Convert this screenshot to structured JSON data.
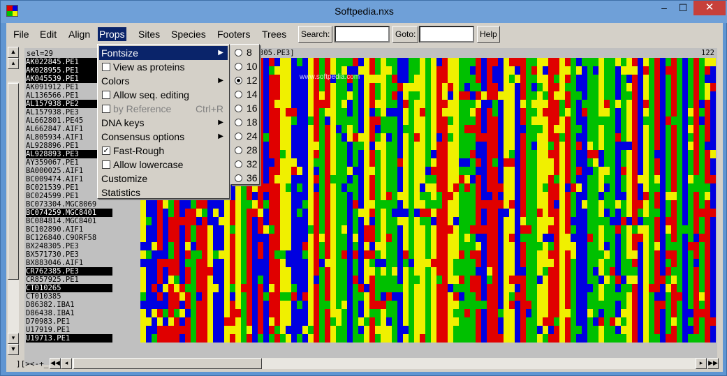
{
  "window": {
    "title": "Softpedia.nxs",
    "minimize": "–",
    "maximize": "☐",
    "close": "✕"
  },
  "menubar": {
    "items": [
      "File",
      "Edit",
      "Align",
      "Props",
      "Sites",
      "Species",
      "Footers",
      "Trees"
    ],
    "active": "Props",
    "search_label": "Search:",
    "search_value": "",
    "goto_label": "Goto:",
    "goto_value": "",
    "help_label": "Help"
  },
  "alignment": {
    "sel_text": "sel=29",
    "header_text": "305.PE3]",
    "position": "122",
    "names": [
      {
        "name": "AK022845.PE1",
        "selected": true
      },
      {
        "name": "AK028955.PE1",
        "selected": true
      },
      {
        "name": "AK045539.PE1",
        "selected": true
      },
      {
        "name": "AK091912.PE1",
        "selected": false
      },
      {
        "name": "AL136566.PE1",
        "selected": false
      },
      {
        "name": "AL157938.PE2",
        "selected": true
      },
      {
        "name": "AL157938.PE3",
        "selected": false
      },
      {
        "name": "AL662801.PE45",
        "selected": false
      },
      {
        "name": "AL662847.AIF1",
        "selected": false
      },
      {
        "name": "AL805934.AIF1",
        "selected": false
      },
      {
        "name": "AL928896.PE1",
        "selected": false
      },
      {
        "name": "AL928893.PE3",
        "selected": true
      },
      {
        "name": "AY359067.PE1",
        "selected": false
      },
      {
        "name": "BA000025.AIF1",
        "selected": false
      },
      {
        "name": "BC009474.AIF1",
        "selected": false
      },
      {
        "name": "BC021539.PE1",
        "selected": false
      },
      {
        "name": "BC024599.PE1",
        "selected": false
      },
      {
        "name": "BC073304.MGC8069",
        "selected": false
      },
      {
        "name": "BC074259.MGC8401",
        "selected": true
      },
      {
        "name": "BC084814.MGC8401",
        "selected": false
      },
      {
        "name": "BC102890.AIF1",
        "selected": false
      },
      {
        "name": "BC126840.C9ORF58",
        "selected": false
      },
      {
        "name": "BX248305.PE3",
        "selected": false
      },
      {
        "name": "BX571730.PE3",
        "selected": false
      },
      {
        "name": "BX883046.AIF1",
        "selected": false
      },
      {
        "name": "CR762385.PE3",
        "selected": true
      },
      {
        "name": "CR857925.PE1",
        "selected": false
      },
      {
        "name": "CT010265",
        "selected": true
      },
      {
        "name": "CT010385",
        "selected": false
      },
      {
        "name": "D86382.IBA1",
        "selected": false
      },
      {
        "name": "D86438.IBA1",
        "selected": false
      },
      {
        "name": "D70983.PE1",
        "selected": false
      },
      {
        "name": "U17919.PE1",
        "selected": false
      },
      {
        "name": "U19713.PE1",
        "selected": true
      }
    ],
    "base_colors": {
      "A": "#e00000",
      "C": "#00c000",
      "G": "#f0f000",
      "T": "#0000e0"
    }
  },
  "props_menu": {
    "items": [
      {
        "label": "Fontsize",
        "type": "submenu",
        "highlighted": true
      },
      {
        "label": "View as proteins",
        "type": "check",
        "checked": false
      },
      {
        "label": "Colors",
        "type": "submenu"
      },
      {
        "label": "Allow seq. editing",
        "type": "check",
        "checked": false
      },
      {
        "label": "by Reference",
        "type": "check",
        "checked": false,
        "disabled": true,
        "shortcut": "Ctrl+R"
      },
      {
        "label": "DNA keys",
        "type": "submenu"
      },
      {
        "label": "Consensus options",
        "type": "submenu"
      },
      {
        "label": "Fast-Rough",
        "type": "check",
        "checked": true
      },
      {
        "label": "Allow lowercase",
        "type": "check",
        "checked": false
      },
      {
        "label": "Customize",
        "type": "plain"
      },
      {
        "label": "Statistics",
        "type": "plain"
      }
    ]
  },
  "fontsize_submenu": {
    "options": [
      "8",
      "10",
      "12",
      "14",
      "16",
      "18",
      "24",
      "28",
      "32",
      "36"
    ],
    "selected": "12"
  },
  "status": {
    "mode_label": "][><-+_"
  },
  "watermark": "www.softpedia.com"
}
